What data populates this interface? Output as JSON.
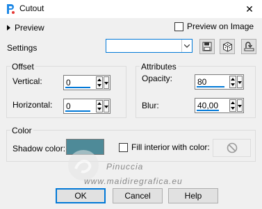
{
  "window": {
    "title": "Cutout",
    "close_glyph": "✕"
  },
  "preview": {
    "label": "Preview",
    "preview_on_image_label": "Preview on Image",
    "preview_on_image_checked": false
  },
  "settings": {
    "label": "Settings",
    "preset_value": ""
  },
  "offset": {
    "group_label": "Offset",
    "vertical_label": "Vertical:",
    "vertical_value": "0",
    "horizontal_label": "Horizontal:",
    "horizontal_value": "0"
  },
  "attributes": {
    "group_label": "Attributes",
    "opacity_label": "Opacity:",
    "opacity_value": "80",
    "blur_label": "Blur:",
    "blur_value": "40,00"
  },
  "color": {
    "group_label": "Color",
    "shadow_color_label": "Shadow color:",
    "shadow_color": "#4e8a98",
    "fill_interior_label": "Fill interior with color:",
    "fill_interior_checked": false
  },
  "watermark": {
    "line1": "Pinuccia",
    "line2": "www.maidiregrafica.eu"
  },
  "buttons": {
    "ok": "OK",
    "cancel": "Cancel",
    "help": "Help"
  },
  "colors": {
    "accent": "#0078d7",
    "dialog_bg": "#f0f0f0"
  }
}
